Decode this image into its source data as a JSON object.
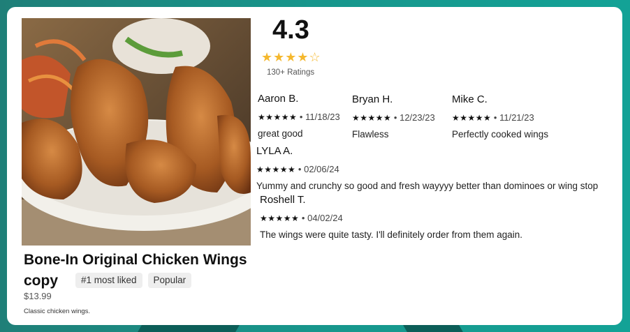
{
  "item": {
    "title": "Bone-In Original Chicken Wings",
    "title_line2": "copy",
    "tags": [
      "#1 most liked",
      "Popular"
    ],
    "price": "$13.99",
    "description": "Classic chicken wings."
  },
  "rating": {
    "value": "4.3",
    "stars": "★★★★☆",
    "count": "130+ Ratings"
  },
  "reviews": [
    {
      "name": "Aaron B.",
      "stars": "★★★★★",
      "date": "11/18/23",
      "text": "great good"
    },
    {
      "name": "Bryan H.",
      "stars": "★★★★★",
      "date": "12/23/23",
      "text": "Flawless"
    },
    {
      "name": "Mike C.",
      "stars": "★★★★★",
      "date": "11/21/23",
      "text": "Perfectly cooked wings"
    },
    {
      "name": "LYLA A.",
      "stars": "★★★★★",
      "date": "02/06/24",
      "text": "Yummy and crunchy so good and fresh wayyyy better than dominoes or wing stop"
    },
    {
      "name": "Roshell T.",
      "stars": "★★★★★",
      "date": "04/02/24",
      "text": "The wings were quite tasty. I'll definitely order from them again."
    }
  ]
}
